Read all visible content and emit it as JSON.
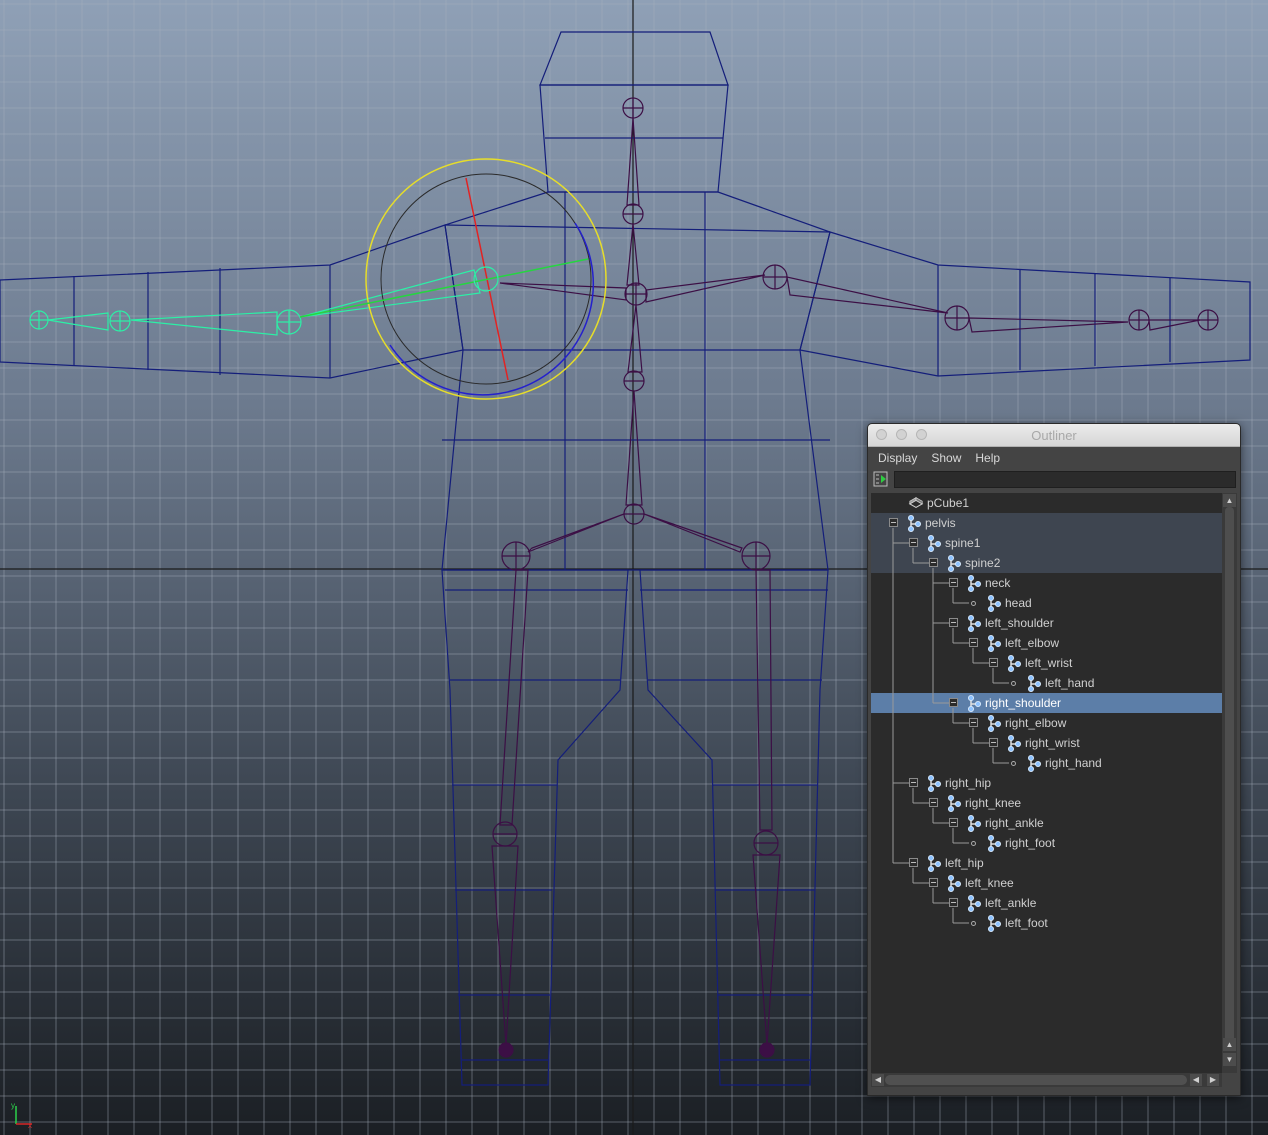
{
  "viewport": {
    "axis_labels": {
      "x": "x",
      "y": "y"
    },
    "colors": {
      "grid": "#a7b0bd",
      "mesh_wire": "#141e7a",
      "joint_unselected": "#3c0f45",
      "joint_selected": "#2cf0a6",
      "rotate_outer": "#e6dd2a",
      "rotate_x": "#e22323",
      "rotate_y": "#25d640",
      "rotate_z": "#2420cc"
    }
  },
  "outliner": {
    "window_title": "Outliner",
    "menus": [
      "Display",
      "Show",
      "Help"
    ],
    "filter_value": "",
    "nodes": [
      {
        "label": "pCube1",
        "icon": "mesh-icon"
      },
      {
        "label": "pelvis",
        "icon": "joint-icon"
      },
      {
        "label": "spine1",
        "icon": "joint-icon"
      },
      {
        "label": "spine2",
        "icon": "joint-icon"
      },
      {
        "label": "neck",
        "icon": "joint-icon"
      },
      {
        "label": "head",
        "icon": "joint-icon"
      },
      {
        "label": "left_shoulder",
        "icon": "joint-icon"
      },
      {
        "label": "left_elbow",
        "icon": "joint-icon"
      },
      {
        "label": "left_wrist",
        "icon": "joint-icon"
      },
      {
        "label": "left_hand",
        "icon": "joint-icon"
      },
      {
        "label": "right_shoulder",
        "icon": "joint-icon",
        "selected": true
      },
      {
        "label": "right_elbow",
        "icon": "joint-icon"
      },
      {
        "label": "right_wrist",
        "icon": "joint-icon"
      },
      {
        "label": "right_hand",
        "icon": "joint-icon"
      },
      {
        "label": "right_hip",
        "icon": "joint-icon"
      },
      {
        "label": "right_knee",
        "icon": "joint-icon"
      },
      {
        "label": "right_ankle",
        "icon": "joint-icon"
      },
      {
        "label": "right_foot",
        "icon": "joint-icon"
      },
      {
        "label": "left_hip",
        "icon": "joint-icon"
      },
      {
        "label": "left_knee",
        "icon": "joint-icon"
      },
      {
        "label": "left_ankle",
        "icon": "joint-icon"
      },
      {
        "label": "left_foot",
        "icon": "joint-icon"
      }
    ],
    "colors": {
      "selected_row": "#5c7ea8",
      "parent_row": "#3e4550",
      "panel_bg": "#2b2b2b"
    }
  }
}
